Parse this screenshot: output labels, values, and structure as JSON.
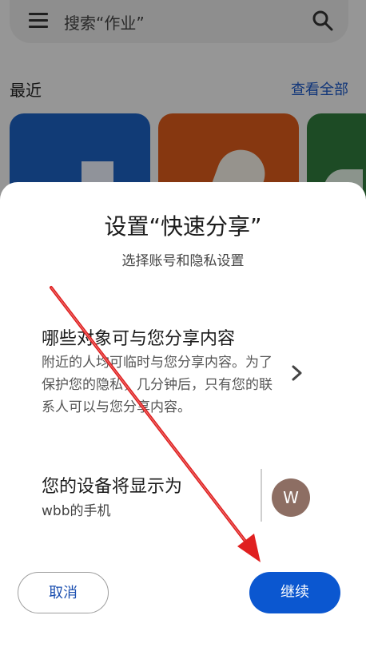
{
  "background": {
    "search_placeholder": "搜索“作业”",
    "recent_label": "最近",
    "see_all_label": "查看全部"
  },
  "sheet": {
    "title": "设置“快速分享”",
    "subtitle": "选择账号和隐私设置",
    "visibility": {
      "title": "哪些对象可与您分享内容",
      "description": "附近的人均可临时与您分享内容。为了保护您的隐私，几分钟后，只有您的联系人可以与您分享内容。"
    },
    "device": {
      "title": "您的设备将显示为",
      "name": "wbb的手机",
      "avatar_letter": "W"
    },
    "buttons": {
      "cancel": "取消",
      "continue": "继续"
    }
  },
  "colors": {
    "primary": "#0b57d0",
    "avatar": "#8d6e63",
    "annotation_arrow": "#e02020"
  }
}
